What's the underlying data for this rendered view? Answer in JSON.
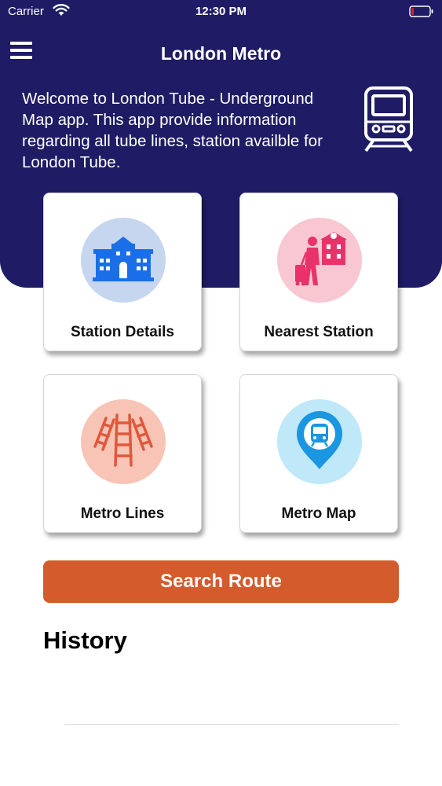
{
  "status_bar": {
    "carrier": "Carrier",
    "time": "12:30 PM",
    "battery_color": "#e02020"
  },
  "header": {
    "title": "London Metro",
    "background_color": "#1f1c65",
    "welcome_text": "Welcome to London Tube - Underground Map app. This app provide information regarding all tube lines, station availble for London Tube.",
    "menu_icon": "hamburger-menu-icon",
    "header_icon": "train-icon"
  },
  "cards": [
    {
      "label": "Station Details",
      "icon": "station-building-icon",
      "circle_color": "#c5d6ee",
      "icon_color": "#1a6fe8"
    },
    {
      "label": "Nearest Station",
      "icon": "traveler-icon",
      "circle_color": "#f8c7d2",
      "icon_color": "#e8336a"
    },
    {
      "label": "Metro Lines",
      "icon": "rail-tracks-icon",
      "circle_color": "#f7c4b6",
      "icon_color": "#e0583c"
    },
    {
      "label": "Metro Map",
      "icon": "location-pin-icon",
      "circle_color": "#bfe8f8",
      "icon_color": "#1b96e0"
    }
  ],
  "search_button": {
    "label": "Search Route",
    "color": "#d35b2c"
  },
  "history": {
    "title": "History"
  }
}
